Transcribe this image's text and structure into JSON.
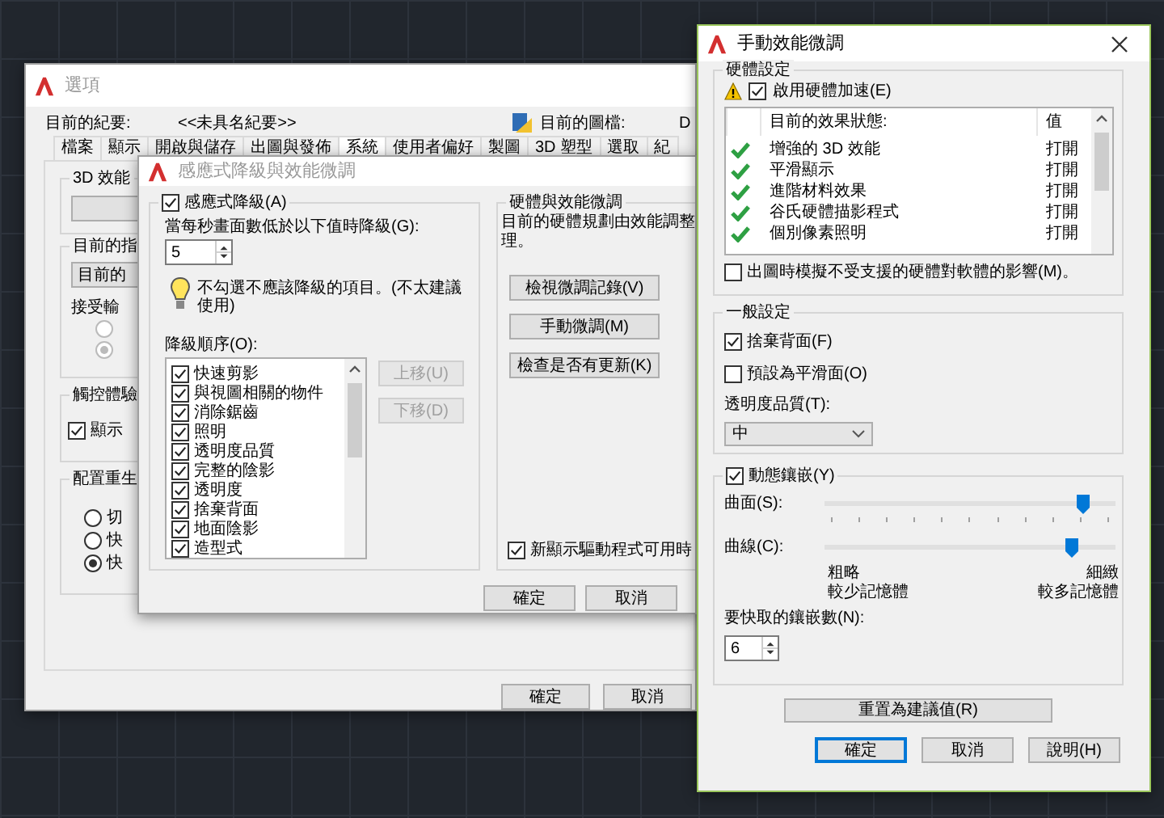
{
  "options_window": {
    "title": "選項",
    "active": false,
    "profile_label": "目前的紀要:",
    "profile": "<<未具名紀要>>",
    "drawing_label": "目前的圖檔:",
    "drawing": "D",
    "tabs": [
      {
        "label": "檔案",
        "selected": false
      },
      {
        "label": "顯示",
        "selected": false
      },
      {
        "label": "開啟與儲存",
        "selected": false
      },
      {
        "label": "出圖與發佈",
        "selected": false
      },
      {
        "label": "系統",
        "selected": true
      },
      {
        "label": "使用者偏好",
        "selected": false
      },
      {
        "label": "製圖",
        "selected": false
      },
      {
        "label": "3D 塑型",
        "selected": false
      },
      {
        "label": "選取",
        "selected": false
      },
      {
        "label": "紀",
        "selected": false
      }
    ],
    "performance_group": {
      "title": "3D 效能"
    },
    "pointing_group": {
      "title": "目前的指",
      "button": "目前的",
      "input_label": "接受輸",
      "options": [
        {
          "selected": false,
          "disabled": true
        },
        {
          "selected": true,
          "disabled": true
        }
      ]
    },
    "touch_group": {
      "title": "觸控體驗",
      "checkbox": {
        "label": "顯示",
        "checked": true
      }
    },
    "regen_group": {
      "title": "配置重生",
      "options": [
        {
          "label": "切",
          "selected": false
        },
        {
          "label": "快",
          "selected": false
        },
        {
          "label": "快",
          "selected": true
        }
      ]
    },
    "buttons": [
      "確定",
      "取消"
    ]
  },
  "degradation_window": {
    "title": "感應式降級與效能微調",
    "active": false,
    "adaptive": {
      "label": "感應式降級(A)",
      "checked": true
    },
    "fps_label": "當每秒畫面數低於以下值時降級(G):",
    "fps_value": "5",
    "hint": "不勾選不應該降級的項目。(不太建議使用)",
    "order_label": "降級順序(O):",
    "order_items": [
      {
        "label": "快速剪影",
        "checked": true
      },
      {
        "label": "與視圖相關的物件",
        "checked": true
      },
      {
        "label": "消除鋸齒",
        "checked": true
      },
      {
        "label": "照明",
        "checked": true
      },
      {
        "label": "透明度品質",
        "checked": true
      },
      {
        "label": "完整的陰影",
        "checked": true
      },
      {
        "label": "透明度",
        "checked": true
      },
      {
        "label": "捨棄背面",
        "checked": true
      },
      {
        "label": "地面陰影",
        "checked": true
      },
      {
        "label": "造型式",
        "checked": true
      }
    ],
    "move_buttons": [
      {
        "label": "上移(U)",
        "disabled": true
      },
      {
        "label": "下移(D)",
        "disabled": true
      }
    ],
    "tuning": {
      "title": "硬體與效能微調",
      "description": [
        "目前的硬體規劃由效能調整",
        "理。"
      ],
      "buttons": [
        "檢視微調記錄(V)",
        "手動微調(M)",
        "檢查是否有更新(K)"
      ],
      "driver_notify": {
        "label": "新顯示驅動程式可用時",
        "checked": true
      }
    },
    "buttons": [
      "確定",
      "取消"
    ]
  },
  "tuning_window": {
    "title": "手動效能微調",
    "active": true,
    "hardware": {
      "title": "硬體設定",
      "acceleration": {
        "label": "啟用硬體加速(E)",
        "checked": true
      },
      "columns": [
        "目前的效果狀態:",
        "值"
      ],
      "effects": [
        {
          "name": "增強的 3D 效能",
          "value": "打開",
          "enabled": true
        },
        {
          "name": "平滑顯示",
          "value": "打開",
          "enabled": true
        },
        {
          "name": "進階材料效果",
          "value": "打開",
          "enabled": true
        },
        {
          "name": "谷氏硬體描影程式",
          "value": "打開",
          "enabled": true
        },
        {
          "name": "個別像素照明",
          "value": "打開",
          "enabled": true
        }
      ],
      "emulate": {
        "label": "出圖時模擬不受支援的硬體對軟體的影響(M)。",
        "checked": false
      }
    },
    "general": {
      "title": "一般設定",
      "options": [
        {
          "label": "捨棄背面(F)",
          "checked": true
        },
        {
          "label": "預設為平滑面(O)",
          "checked": false
        }
      ],
      "transparency_label": "透明度品質(T):",
      "transparency": "中"
    },
    "tessellation": {
      "label": "動態鑲嵌(Y)",
      "checked": true,
      "sliders": [
        {
          "label": "曲面(S):",
          "level": 0.89
        },
        {
          "label": "曲線(C):",
          "level": 0.85
        }
      ],
      "scale_low": [
        "粗略",
        "較少記憶體"
      ],
      "scale_high": [
        "細緻",
        "較多記憶體"
      ],
      "cache_label": "要快取的鑲嵌數(N):",
      "cache_value": "6"
    },
    "reset": "重置為建議值(R)",
    "buttons": [
      {
        "label": "確定",
        "default": true
      },
      {
        "label": "取消",
        "default": false
      },
      {
        "label": "說明(H)",
        "default": false
      }
    ]
  }
}
